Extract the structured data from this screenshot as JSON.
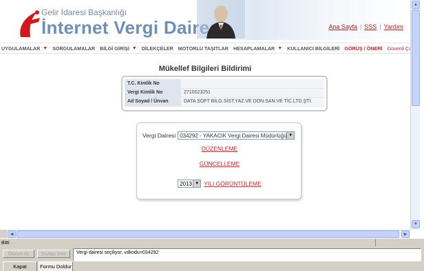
{
  "header": {
    "subtitle": "Gelir İdaresi Başkanlığı",
    "title": "İnternet Vergi Dairesi",
    "links": [
      "Ana Sayfa",
      "SSS",
      "Yardım"
    ]
  },
  "menu": [
    {
      "label": "UYGULAMALAR",
      "arrow": "▼"
    },
    {
      "label": "SORGULAMALAR",
      "arrow": ""
    },
    {
      "label": "BİLGİ GİRİŞİ",
      "arrow": "▼"
    },
    {
      "label": "DİLEKÇELER",
      "arrow": ""
    },
    {
      "label": "MOTORLU TAŞITLAR",
      "arrow": ""
    },
    {
      "label": "HESAPLAMALAR",
      "arrow": "▼"
    },
    {
      "label": "KULLANICI BİLGİLERİ",
      "arrow": ""
    },
    {
      "label": "GÖRÜŞ / ÖNERİ",
      "arrow": ""
    },
    {
      "label": "Güvenli Çıkış",
      "arrow": ""
    }
  ],
  "page": {
    "title": "Mükellef Bilgileri Bildirimi",
    "info": [
      {
        "label": "T.C. Kimlik No",
        "value": ""
      },
      {
        "label": "Vergi Kimlik No",
        "value": "2710023251"
      },
      {
        "label": "Ad Soyad / Ünvan",
        "value": "DATA SOFT BİLG.SİST.YAZ.VE DON.SAN.VE TİC.LTD.ŞTİ."
      }
    ],
    "vergi_dairesi_label": "Vergi Dairesi",
    "vergi_dairesi_value": "034292 - YAKACIK Vergi Dairesi Müdürlüğü",
    "duzenleme": "DÜZENLEME",
    "guncelleme": "GÜNCELLEME",
    "year_value": "2013",
    "year_link": "YILI GÖRÜNTÜLEME"
  },
  "status": {
    "text": "Bitti",
    "button_oturum": "Oturum Aç",
    "button_sayfayi": "Sayfayı İndir",
    "message": "Vergi dairesi seçiliyor, vdkodu=034292",
    "tab_kapat": "Kapat",
    "tab_formu": "Formu Doldur"
  },
  "colors": {
    "accent": "#c0272d",
    "brand_blue": "#6f8fb4",
    "label_bg": "#dfe5ee"
  }
}
